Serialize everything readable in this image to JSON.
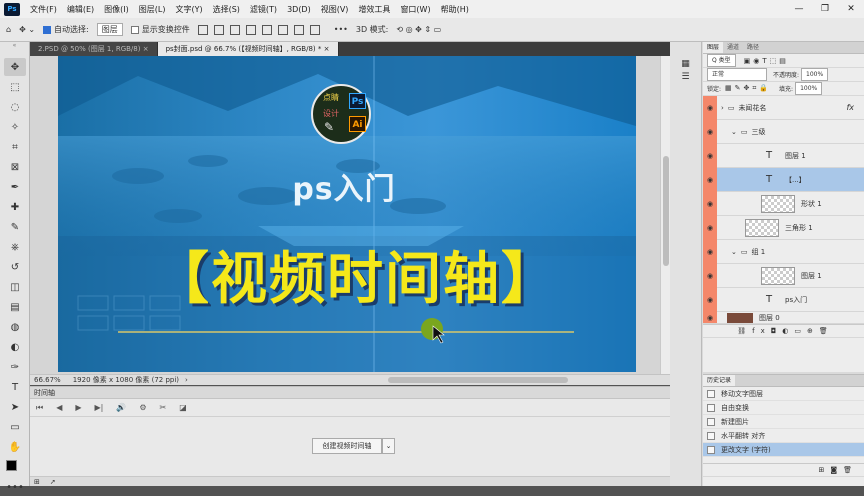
{
  "app": {
    "logo": "Ps",
    "icon": "photoshop-logo"
  },
  "menu": [
    "文件(F)",
    "编辑(E)",
    "图像(I)",
    "图层(L)",
    "文字(Y)",
    "选择(S)",
    "滤镜(T)",
    "3D(D)",
    "视图(V)",
    "增效工具",
    "窗口(W)",
    "帮助(H)"
  ],
  "window_controls": [
    "—",
    "❐",
    "✕"
  ],
  "options": {
    "auto_select_label": "自动选择:",
    "auto_select_value": "图层",
    "show_transform_label": "显示变换控件",
    "more": "•••",
    "mode_3d": "3D 模式:"
  },
  "tabs": [
    {
      "label": "2.PSD @ 50% (图层 1, RGB/8)",
      "close": "×",
      "active": false
    },
    {
      "label": "ps封面.psd @ 66.7% (【视频时间轴】, RGB/8) *",
      "close": "×",
      "active": true
    }
  ],
  "artwork": {
    "logo_top": "点睛",
    "logo_mid": "设计",
    "logo_ps": "Ps",
    "logo_ai": "Ai",
    "subtitle": "ps入门",
    "headline": "【视频时间轴】",
    "headline_color": "#f5e81a",
    "bg_accent": "#2d87c5"
  },
  "status": {
    "zoom": "66.67%",
    "doc_info": "1920 像素 x 1080 像素 (72 ppi)",
    "arrow": "›"
  },
  "timeline": {
    "title": "时间轴",
    "create_button": "创建视频时间轴",
    "dropdown": "⌄",
    "controls": [
      "⏮",
      "◀",
      "▶",
      "▶|",
      "🔊",
      "⚙",
      "✂",
      "◪"
    ]
  },
  "layers_panel": {
    "tabs": [
      "图层",
      "通道",
      "路径"
    ],
    "filter_label": "Q 类型",
    "blend_mode": "正常",
    "opacity_label": "不透明度:",
    "opacity_value": "100%",
    "lock_label": "锁定:",
    "fill_label": "填充:",
    "fill_value": "100%",
    "layers": [
      {
        "name": "未闻花名",
        "kind": "group",
        "fx": "fx"
      },
      {
        "name": "三级",
        "kind": "group"
      },
      {
        "name": "图层 1",
        "kind": "text"
      },
      {
        "name": "【...】",
        "kind": "text",
        "selected": true
      },
      {
        "name": "形状 1",
        "kind": "image"
      },
      {
        "name": "三角形 1",
        "kind": "image"
      },
      {
        "name": "组 1",
        "kind": "group"
      },
      {
        "name": "图层 1",
        "kind": "image"
      },
      {
        "name": "ps入门",
        "kind": "text"
      },
      {
        "name": "图层 0",
        "kind": "image"
      }
    ],
    "footer_icons": [
      "link",
      "fx",
      "mask",
      "adjust",
      "folder",
      "new",
      "trash"
    ]
  },
  "history_panel": {
    "tabs": [
      "历史记录"
    ],
    "items": [
      {
        "label": "移动文字图层",
        "selected": false
      },
      {
        "label": "自由变换",
        "selected": false
      },
      {
        "label": "新建图片",
        "selected": false
      },
      {
        "label": "水平翻转 对齐",
        "selected": false
      },
      {
        "label": "更改文字 (字符)",
        "selected": true
      }
    ]
  }
}
